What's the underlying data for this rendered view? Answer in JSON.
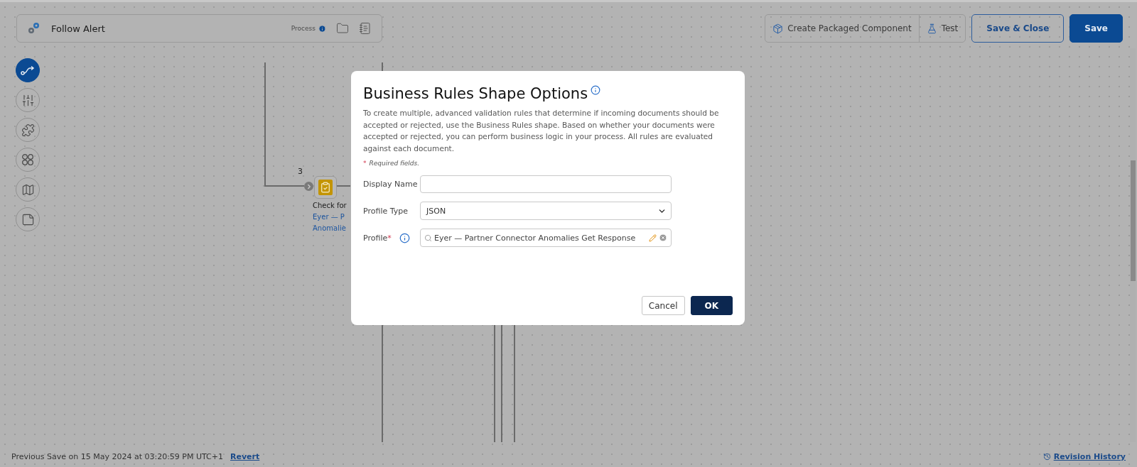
{
  "header": {
    "title": "Follow Alert",
    "type_label": "Process"
  },
  "actions": [
    {
      "label": "Create Packaged Component",
      "kind": "package"
    },
    {
      "label": "Test",
      "kind": "test"
    },
    {
      "label": "Save & Close",
      "kind": "outline"
    },
    {
      "label": "Save",
      "kind": "primary"
    }
  ],
  "rail": [
    {
      "kind": "route",
      "selected": true
    },
    {
      "kind": "sliders",
      "selected": false
    },
    {
      "kind": "puzzle",
      "selected": false
    },
    {
      "kind": "circles",
      "selected": false
    },
    {
      "kind": "map",
      "selected": false
    },
    {
      "kind": "note",
      "selected": false
    }
  ],
  "canvas": {
    "node": {
      "step": "3",
      "label": "Check for",
      "links": [
        "Eyer — P",
        "Anomalie"
      ]
    }
  },
  "dialog": {
    "title": "Business Rules Shape Options",
    "description": "To create multiple, advanced validation rules that determine if incoming documents should be accepted or rejected, use the Business Rules shape. Based on whether your documents were accepted or rejected, you can perform business logic in your process. All rules are evaluated against each document.",
    "required_note": {
      "mark": "*",
      "text": "Required fields."
    },
    "fields": [
      {
        "label": "Display Name",
        "kind": "text"
      },
      {
        "label": "Profile Type",
        "kind": "select",
        "value": "JSON"
      },
      {
        "label": "Profile",
        "kind": "lookup",
        "required_mark": "*",
        "value": "Eyer — Partner Connector Anomalies Get Response"
      }
    ],
    "buttons": [
      {
        "label": "Cancel",
        "kind": "secondary"
      },
      {
        "label": "OK",
        "kind": "primary"
      }
    ]
  },
  "footer": {
    "previous_save": "Previous Save on 15 May 2024 at 03:20:59 PM UTC+1",
    "revert": "Revert",
    "revision_history": "Revision History"
  }
}
